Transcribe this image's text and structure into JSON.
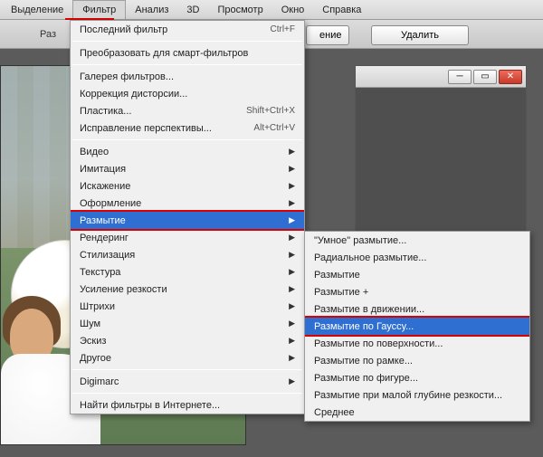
{
  "menubar": {
    "items": [
      "Выделение",
      "Фильтр",
      "Анализ",
      "3D",
      "Просмотр",
      "Окно",
      "Справка"
    ],
    "active_index": 1
  },
  "toolbar": {
    "label": "Раз",
    "button_enie": "ение",
    "button_delete": "Удалить"
  },
  "panel": {
    "min": "—",
    "max": "□",
    "close": "×"
  },
  "filter_menu": {
    "last_filter": {
      "label": "Последний фильтр",
      "shortcut": "Ctrl+F"
    },
    "smart": {
      "label": "Преобразовать для смарт-фильтров"
    },
    "gallery": "Галерея фильтров...",
    "distort_corr": "Коррекция дисторсии...",
    "liquify": {
      "label": "Пластика...",
      "shortcut": "Shift+Ctrl+X"
    },
    "perspective": {
      "label": "Исправление перспективы...",
      "shortcut": "Alt+Ctrl+V"
    },
    "submenus": [
      "Видео",
      "Имитация",
      "Искажение",
      "Оформление",
      "Размытие",
      "Рендеринг",
      "Стилизация",
      "Текстура",
      "Усиление резкости",
      "Штрихи",
      "Шум",
      "Эскиз",
      "Другое"
    ],
    "digimarc": "Digimarc",
    "find": "Найти фильтры в Интернете..."
  },
  "blur_submenu": [
    "\"Умное\" размытие...",
    "Радиальное размытие...",
    "Размытие",
    "Размытие +",
    "Размытие в движении...",
    "Размытие по Гауссу...",
    "Размытие по поверхности...",
    "Размытие по рамке...",
    "Размытие по фигуре...",
    "Размытие при малой глубине резкости...",
    "Среднее"
  ],
  "blur_highlight_index": 5
}
